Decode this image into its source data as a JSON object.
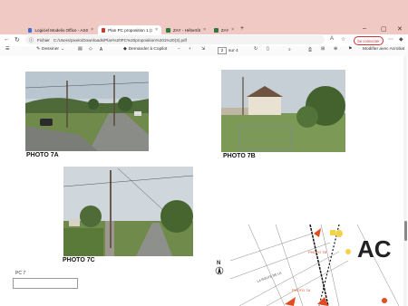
{
  "browser": {
    "tabs": [
      {
        "label": "Logiciel Modelio Office - ASSUR",
        "color": "#3a6fd8"
      },
      {
        "label": "Plan PC proposition 1 (3).pdf",
        "color": "#c23b2b"
      },
      {
        "label": "ZAY - Hébertôt",
        "color": "#2b7a3b"
      },
      {
        "label": "ZAY",
        "color": "#2b7a3b"
      }
    ],
    "new_tab": "+",
    "window_controls": [
      "–",
      "▢",
      "✕"
    ]
  },
  "address": {
    "file_label": "Fichier",
    "url": "C:/Users/pixelo/Downloads/Plan%20PC%20proposition%201%20(3).pdf",
    "signin": "Se connecter"
  },
  "pdf_toolbar": {
    "draw": "Dessiner",
    "copilot": "Demander à Copilot",
    "page_current": "2",
    "page_total": "sur 4",
    "edit_acrobat": "Modifier avec Acrobat"
  },
  "photos": {
    "a": "PHOTO 7A",
    "b": "PHOTO 7B",
    "c": "PHOTO 7C"
  },
  "map": {
    "label_road": "LA ROUTE DE LA",
    "label_7a": "PHOTO 7A",
    "label_7b": "PHOTO 7B",
    "big": "AC",
    "north": "N"
  },
  "page_label": "PC 7"
}
